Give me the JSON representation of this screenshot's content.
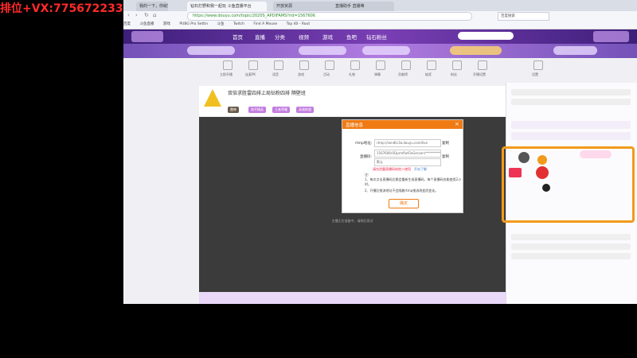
{
  "overlay": {
    "ad_text": "排位+VX:775672233"
  },
  "browser": {
    "tabs": [
      {
        "label": "我的一下，你就知道"
      },
      {
        "label": "钻石打野和我一起玩 斗鱼直播平台"
      },
      {
        "label": "开放资源"
      },
      {
        "label": "直播助手 直播等"
      }
    ],
    "url": "https://www.douyu.com/topic/2020S_APDIFAMS?rid=1567606",
    "secure_text": "斗鱼",
    "search_box": "百度搜索",
    "bookmarks": [
      "百度",
      "斗鱼直播",
      "游戏",
      "PUBG Pro Settin",
      "斗鱼",
      "Twitch",
      "Find A Mouse",
      "Top 40 - Rout"
    ]
  },
  "site": {
    "nav": [
      "首页",
      "直播",
      "分类",
      "视频",
      "游戏",
      "鱼吧",
      "钻石粉丝"
    ]
  },
  "player": {
    "title": "双倍求胜雷四排上局钻粉四排 隔壁班",
    "tags": [
      "雷神",
      "和平精英",
      "王者荣耀",
      "英雄联盟"
    ],
    "message": "主播正在准备中，请稍后再试"
  },
  "icons_row": [
    "立即开播",
    "连麦PK",
    "语音",
    "游戏",
    "活动",
    "礼物",
    "弹幕",
    "贡献榜",
    "抽奖",
    "粉丝",
    "开播设置",
    "设置"
  ],
  "dialog": {
    "title": "直播信息",
    "close": "×",
    "rtmp_label": "rtmp地址:",
    "rtmp_value": "rtmp://sendtc3a.douyu.com/live",
    "rtmp_copy": "复制",
    "code_label": "直播码:",
    "code_value": "1567606rSOprmflutFixGervers***********",
    "code_copy": "复制",
    "select_value": "默认",
    "warn": "请勿泄露直播码给他人使用",
    "warn_link": "开启了解",
    "notes_title": "注:",
    "note1": "1、每次点击直播码后都会重新生成直播码，每个直播码仅能使用2小时。",
    "note2": "2、开播后推流地址不会随着rtmp推流改变而变化。",
    "ok": "确定"
  },
  "colors": {
    "accent": "#f07b14",
    "overlay_border": "#f29a1c",
    "header": "#6a34a8",
    "ad": "#ff2a2a"
  }
}
